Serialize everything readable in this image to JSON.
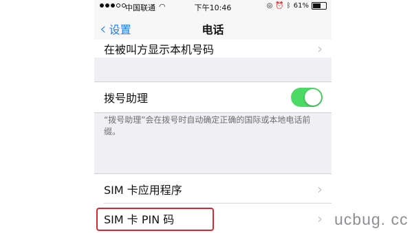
{
  "status_bar": {
    "signal_dots_filled": 3,
    "signal_dots_total": 5,
    "carrier": "中国联通",
    "wifi_icon": "wifi-icon",
    "time": "下午10:46",
    "right_icons": [
      "lock-rotation-icon",
      "alarm-icon",
      "bluetooth-icon"
    ],
    "battery_percent": "61%",
    "battery_level": 0.61
  },
  "nav": {
    "back_label": "设置",
    "title": "电话"
  },
  "cells": {
    "show_caller_id": "在被叫方显示本机号码",
    "dial_assist": "拨号助理",
    "dial_assist_enabled": true,
    "dial_assist_note": "“拨号助理”会在拨号时自动确定正确的国际或本地电话前缀。",
    "sim_apps": "SIM 卡应用程序",
    "sim_pin": "SIM 卡 PIN 码"
  },
  "colors": {
    "accent": "#1a7cf5",
    "toggle_on": "#4cd964",
    "highlight": "#d8262e"
  },
  "watermark": "ucbug. cc"
}
